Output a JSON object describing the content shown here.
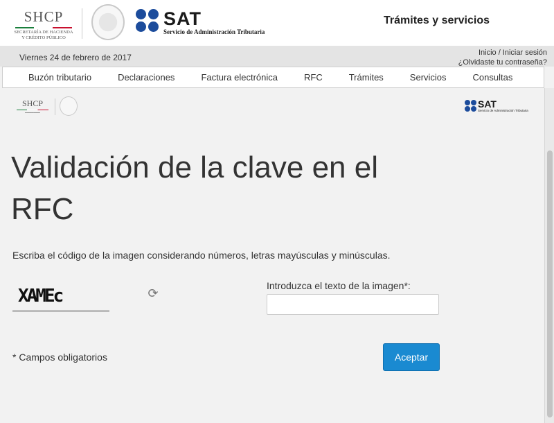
{
  "header": {
    "shcp_logo": "SHCP",
    "shcp_subtitle_1": "SECRETARÍA DE HACIENDA",
    "shcp_subtitle_2": "Y CRÉDITO PÚBLICO",
    "sat_logo": "SAT",
    "sat_subtitle": "Servicio de Administración Tributaria",
    "tramites": "Trámites y servicios",
    "date": "Viernes 24 de febrero de 2017",
    "login_link": "Inicio / Iniciar sesión",
    "forgot_link": "¿Olvidaste tu contraseña?"
  },
  "nav": {
    "items": [
      "Buzón tributario",
      "Declaraciones",
      "Factura electrónica",
      "RFC",
      "Trámites",
      "Servicios",
      "Consultas"
    ]
  },
  "sublogos": {
    "shcp": "SHCP",
    "sat": "SAT",
    "sat_subtitle": "Servicio de Administración Tributaria"
  },
  "main": {
    "title": "Validación de la clave en el RFC",
    "instructions": "Escriba el código de la imagen considerando números, letras mayúsculas y minúsculas.",
    "captcha_code": "XAMEc",
    "refresh_icon": "refresh-icon",
    "input_label": "Introduzca el texto de la imagen*:",
    "input_value": "",
    "required_note": "* Campos obligatorios",
    "submit_label": "Aceptar"
  },
  "colors": {
    "accent": "#1a8ad1",
    "sat_blue": "#1c4c9c",
    "background": "#f2f2f2"
  }
}
